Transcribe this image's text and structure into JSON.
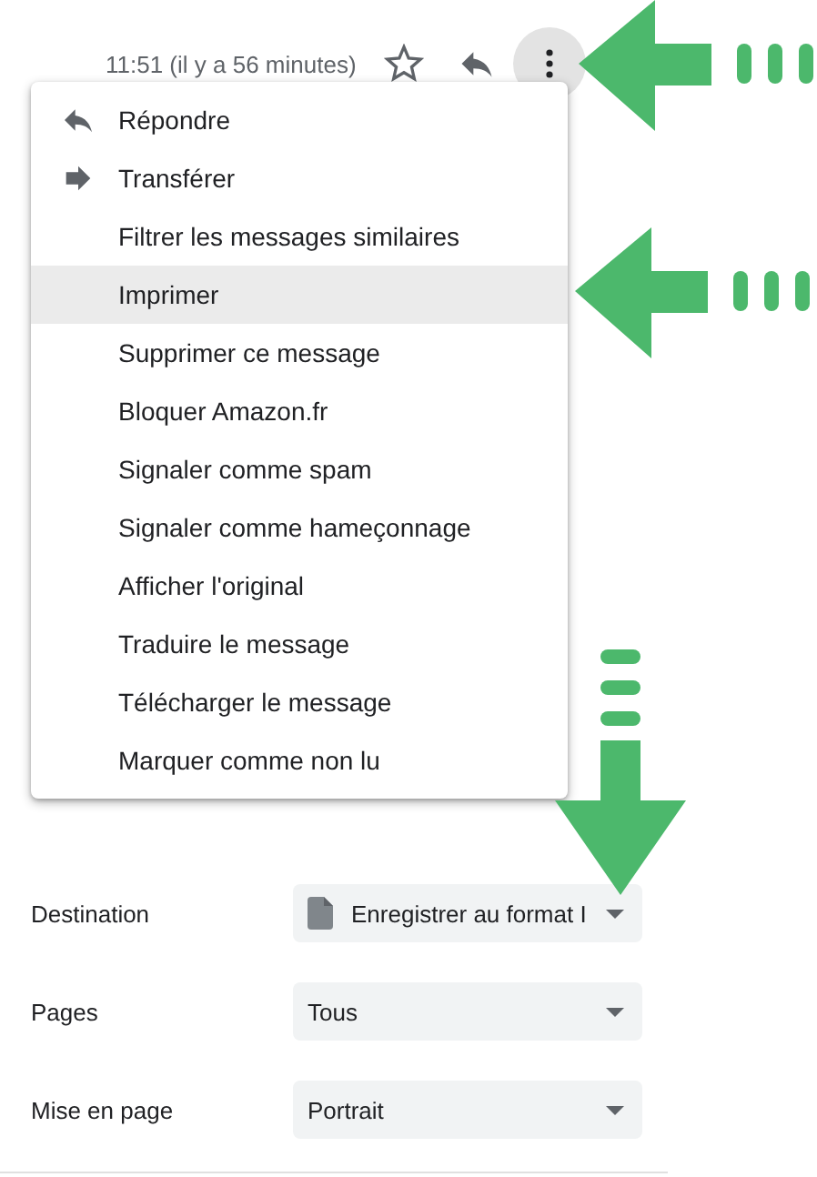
{
  "header": {
    "time": "11:51 (il y a 56 minutes)",
    "starred": false,
    "more_active": true
  },
  "menu": {
    "items": [
      {
        "label": "Répondre",
        "kind": "reply",
        "selected": false
      },
      {
        "label": "Transférer",
        "kind": "forward",
        "selected": false
      },
      {
        "label": "Filtrer les messages similaires",
        "kind": "plain",
        "selected": false
      },
      {
        "label": "Imprimer",
        "kind": "plain",
        "selected": true
      },
      {
        "label": "Supprimer ce message",
        "kind": "plain",
        "selected": false
      },
      {
        "label": "Bloquer Amazon.fr",
        "kind": "plain",
        "selected": false
      },
      {
        "label": "Signaler comme spam",
        "kind": "plain",
        "selected": false
      },
      {
        "label": "Signaler comme hameçonnage",
        "kind": "plain",
        "selected": false
      },
      {
        "label": "Afficher l'original",
        "kind": "plain",
        "selected": false
      },
      {
        "label": "Traduire le message",
        "kind": "plain",
        "selected": false
      },
      {
        "label": "Télécharger le message",
        "kind": "plain",
        "selected": false
      },
      {
        "label": "Marquer comme non lu",
        "kind": "plain",
        "selected": false
      }
    ]
  },
  "print_settings": [
    {
      "label": "Destination",
      "value": "Enregistrer au format I",
      "kind": "file"
    },
    {
      "label": "Pages",
      "value": "Tous",
      "kind": "plain"
    },
    {
      "label": "Mise en page",
      "value": "Portrait",
      "kind": "plain"
    }
  ],
  "annotations": [
    {
      "kind": "left"
    },
    {
      "kind": "left"
    },
    {
      "kind": "down"
    }
  ]
}
